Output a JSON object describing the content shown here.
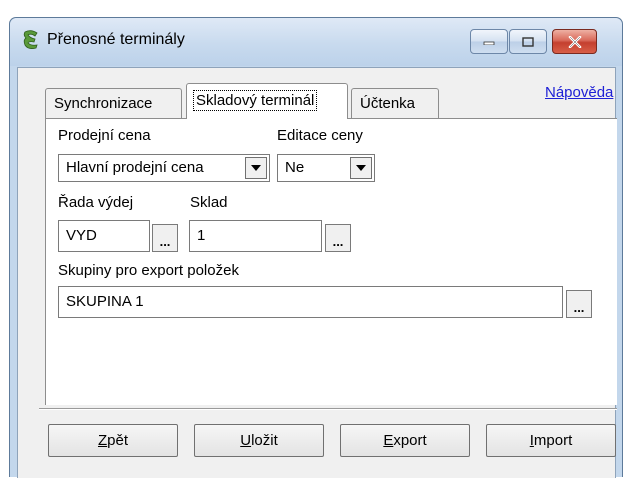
{
  "window": {
    "title": "Přenosné terminály"
  },
  "tabs": [
    {
      "label": "Synchronizace"
    },
    {
      "label": "Skladový terminál"
    },
    {
      "label": "Účtenka"
    }
  ],
  "help_link": "Nápověda",
  "form": {
    "sale_price_label": "Prodejní cena",
    "sale_price_value": "Hlavní prodejní cena",
    "price_edit_label": "Editace ceny",
    "price_edit_value": "Ne",
    "issue_series_label": "Řada výdej",
    "issue_series_value": "VYD",
    "issue_series_browse": "...",
    "warehouse_label": "Sklad",
    "warehouse_value": "1",
    "warehouse_browse": "...",
    "groups_label": "Skupiny pro export položek",
    "groups_value": "SKUPINA 1",
    "groups_browse": "..."
  },
  "buttons": {
    "back_mnemonic": "Z",
    "back_rest": "pět",
    "save_mnemonic": "U",
    "save_rest": "ložit",
    "export_mnemonic": "E",
    "export_rest": "xport",
    "import_mnemonic": "I",
    "import_rest": "mport"
  }
}
